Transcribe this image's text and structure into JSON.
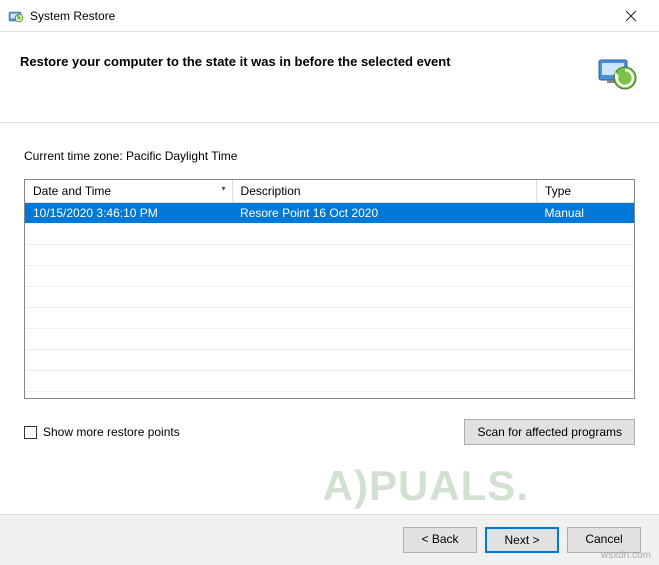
{
  "titlebar": {
    "title": "System Restore"
  },
  "header": {
    "heading": "Restore your computer to the state it was in before the selected event"
  },
  "tz_label": "Current time zone: Pacific Daylight Time",
  "table": {
    "columns": {
      "datetime": "Date and Time",
      "description": "Description",
      "type": "Type"
    },
    "rows": [
      {
        "datetime": "10/15/2020 3:46:10 PM",
        "description": "Resore Point 16 Oct 2020",
        "type": "Manual"
      }
    ]
  },
  "show_more_label": "Show more restore points",
  "scan_label": "Scan for affected programs",
  "footer": {
    "back": "< Back",
    "next": "Next >",
    "cancel": "Cancel"
  },
  "watermark": "A)PUALS.",
  "wsx": "wsxdn.com"
}
